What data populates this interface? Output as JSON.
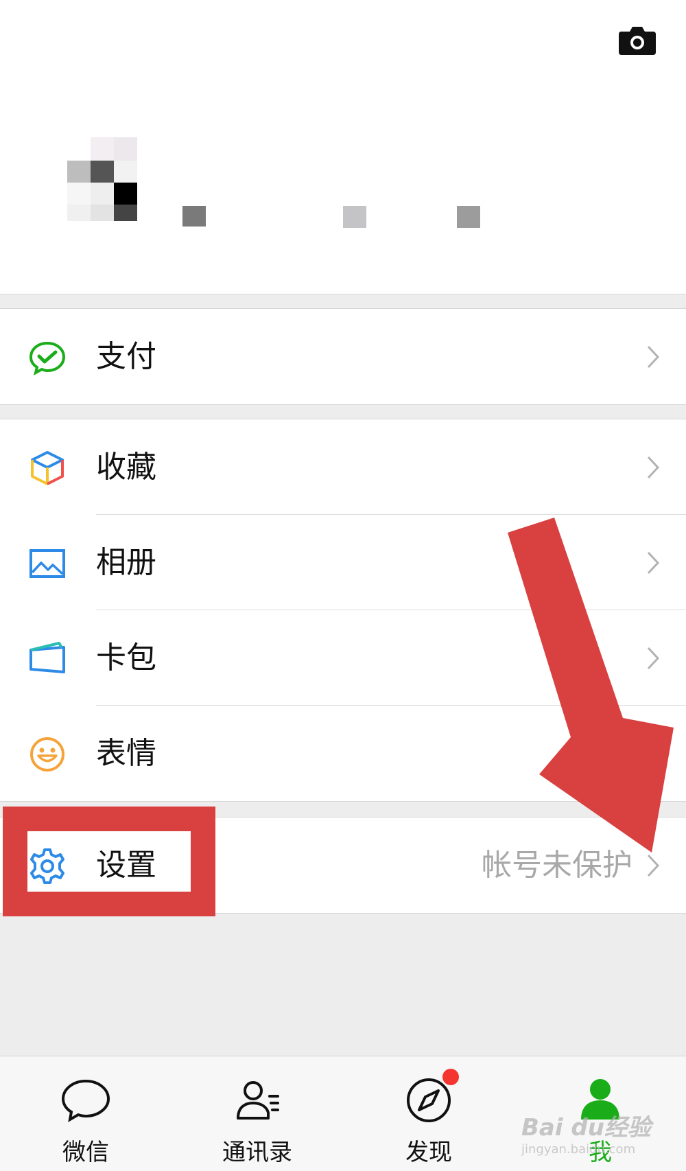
{
  "header": {
    "camera_icon": "camera-icon"
  },
  "menu": {
    "pay": {
      "label": "支付",
      "icon": "wechat-pay-icon"
    },
    "favorites": {
      "label": "收藏",
      "icon": "cube-icon"
    },
    "album": {
      "label": "相册",
      "icon": "image-icon"
    },
    "cards": {
      "label": "卡包",
      "icon": "card-icon"
    },
    "stickers": {
      "label": "表情",
      "icon": "smile-icon"
    },
    "settings": {
      "label": "设置",
      "icon": "gear-icon",
      "status": "帐号未保护"
    }
  },
  "tabbar": {
    "tabs": [
      {
        "label": "微信",
        "icon": "chat-bubble-icon"
      },
      {
        "label": "通讯录",
        "icon": "contacts-icon"
      },
      {
        "label": "发现",
        "icon": "compass-icon"
      },
      {
        "label": "我",
        "icon": "person-icon"
      }
    ],
    "active_index": 3
  },
  "watermark": {
    "brand": "Bai du经验",
    "url": "jingyan.baidu.com"
  },
  "colors": {
    "accent_green": "#1aad19",
    "annotation_red": "#d94040",
    "badge_red": "#f43530",
    "background": "#ededed"
  }
}
